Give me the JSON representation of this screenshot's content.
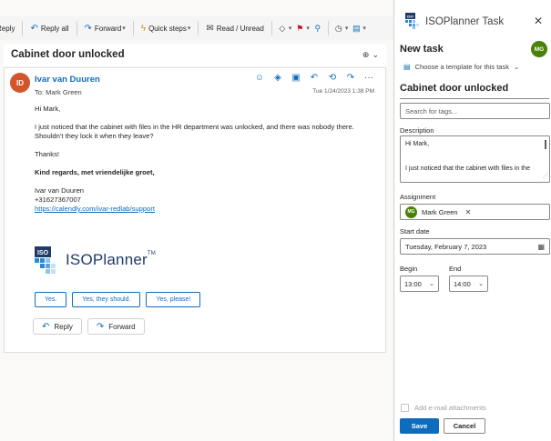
{
  "toolbar": {
    "reply_label": "Reply",
    "reply_all_label": "Reply all",
    "forward_label": "Forward",
    "quick_steps_label": "Quick steps",
    "read_unread_label": "Read / Unread"
  },
  "message": {
    "subject": "Cabinet door unlocked",
    "sender_initials": "ID",
    "sender_name": "Ivar van Duuren",
    "to_label": "To:",
    "recipient": "Mark Green",
    "date": "Tue 1/24/2023 1:38 PM",
    "greeting": "Hi Mark,",
    "body_line1": "I just noticed that the cabinet with files in the HR department was unlocked, and there was nobody there.",
    "body_line2": "Shouldn't they lock it when they leave?",
    "thanks": "Thanks!",
    "regards": "Kind regards, met vriendelijke groet,",
    "signature_name": "Ivar van Duuren",
    "signature_phone": "+31627367007",
    "signature_link": "https://calendly.com/ivar-redlab/support",
    "logo_brand": "ISO",
    "logo_text": "ISOPlanner",
    "logo_tm": "TM",
    "quick_replies": [
      "Yes.",
      "Yes, they should.",
      "Yes, please!"
    ],
    "reply_label": "Reply",
    "forward_label": "Forward"
  },
  "task_pane": {
    "brand_mark": "ISO",
    "title": "ISOPlanner Task",
    "heading": "New task",
    "user_initials": "MG",
    "template_label": "Choose a template for this task",
    "task_name": "Cabinet door unlocked",
    "tags_placeholder": "Search for tags...",
    "description_label": "Description",
    "description_line1": "Hi Mark,",
    "description_line2": "I just noticed that the cabinet with files in the",
    "assignment_label": "Assignment",
    "assignee_initials": "MG",
    "assignee_name": "Mark Green",
    "start_date_label": "Start date",
    "start_date": "Tuesday, February 7, 2023",
    "begin_label": "Begin",
    "begin_time": "13:00",
    "end_label": "End",
    "end_time": "14:00",
    "attachments_label": "Add e-mail attachments",
    "save_label": "Save",
    "cancel_label": "Cancel"
  },
  "colors": {
    "accent": "#0f6cbd",
    "sender_avatar": "#d2562a",
    "user_avatar": "#498205",
    "logo_dark": "#1f3b67"
  },
  "icons": [
    "reply-icon",
    "reply-all-icon",
    "forward-icon",
    "lightning-icon",
    "envelope-icon",
    "tag-icon",
    "flag-icon",
    "pin-icon",
    "clock-icon",
    "move-icon",
    "zoom-icon",
    "emoji-icon",
    "close-icon",
    "calendar-icon",
    "template-icon"
  ]
}
